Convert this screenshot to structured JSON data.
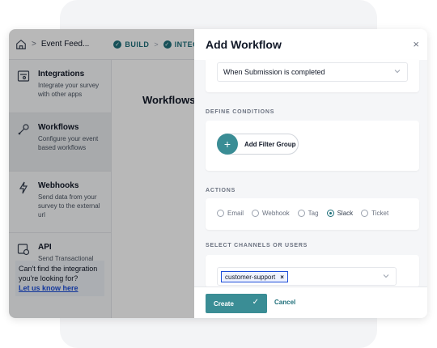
{
  "topbar": {
    "breadcrumb": "Event Feed...",
    "steps": [
      "BUILD",
      "INTEG"
    ]
  },
  "sidebar": {
    "items": [
      {
        "title": "Integrations",
        "desc": "Integrate your survey with other apps"
      },
      {
        "title": "Workflows",
        "desc": "Configure your event based workflows"
      },
      {
        "title": "Webhooks",
        "desc": "Send data from your survey to the external url"
      },
      {
        "title": "API",
        "desc": "Send Transactional"
      }
    ],
    "help_text": "Can't find the integration you're looking for?",
    "help_link": "Let us know here"
  },
  "main": {
    "title": "Workflows"
  },
  "drawer": {
    "title": "Add Workflow",
    "close": "×",
    "trigger_value": "When Submission is completed",
    "conditions_label": "DEFINE CONDITIONS",
    "add_filter_label": "Add Filter Group",
    "actions_label": "ACTIONS",
    "actions": [
      "Email",
      "Webhook",
      "Tag",
      "Slack",
      "Ticket"
    ],
    "selected_action": "Slack",
    "channels_label": "SELECT CHANNELS OR USERS",
    "channel_chip": "customer-support",
    "chip_remove": "×",
    "create_label": "Create",
    "create_check": "✓",
    "cancel_label": "Cancel"
  },
  "colors": {
    "accent": "#3a8d95",
    "step": "#1f6f7a",
    "link": "#1d4ed8"
  }
}
